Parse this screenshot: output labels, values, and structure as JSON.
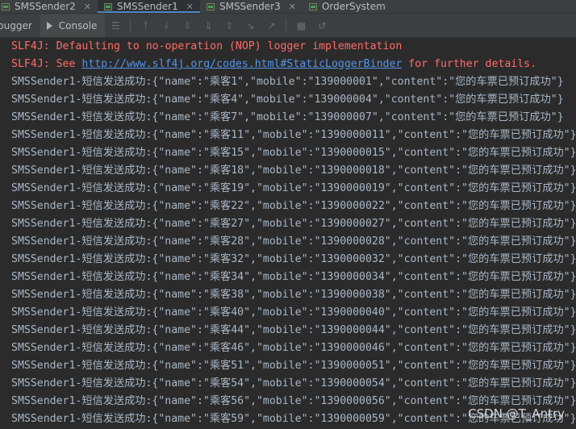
{
  "tabs": [
    {
      "label": "SMSSender2",
      "active": false
    },
    {
      "label": "SMSSender1",
      "active": true
    },
    {
      "label": "SMSSender3",
      "active": false
    },
    {
      "label": "OrderSystem",
      "active": false
    }
  ],
  "toolwindow": {
    "debugger_label": "bugger",
    "console_label": "Console"
  },
  "console": {
    "slf4j_line1": "SLF4J: Defaulting to no-operation (NOP) logger implementation",
    "slf4j_line2_prefix": "SLF4J: See ",
    "slf4j_line2_link": "http://www.slf4j.org/codes.html#StaticLoggerBinder",
    "slf4j_line2_suffix": " for further details.",
    "lines": [
      "SMSSender1-短信发送成功:{\"name\":\"乘客1\",\"mobile\":\"139000001\",\"content\":\"您的车票已预订成功\"}",
      "SMSSender1-短信发送成功:{\"name\":\"乘客4\",\"mobile\":\"139000004\",\"content\":\"您的车票已预订成功\"}",
      "SMSSender1-短信发送成功:{\"name\":\"乘客7\",\"mobile\":\"139000007\",\"content\":\"您的车票已预订成功\"}",
      "SMSSender1-短信发送成功:{\"name\":\"乘客11\",\"mobile\":\"1390000011\",\"content\":\"您的车票已预订成功\"}",
      "SMSSender1-短信发送成功:{\"name\":\"乘客15\",\"mobile\":\"1390000015\",\"content\":\"您的车票已预订成功\"}",
      "SMSSender1-短信发送成功:{\"name\":\"乘客18\",\"mobile\":\"1390000018\",\"content\":\"您的车票已预订成功\"}",
      "SMSSender1-短信发送成功:{\"name\":\"乘客19\",\"mobile\":\"1390000019\",\"content\":\"您的车票已预订成功\"}",
      "SMSSender1-短信发送成功:{\"name\":\"乘客22\",\"mobile\":\"1390000022\",\"content\":\"您的车票已预订成功\"}",
      "SMSSender1-短信发送成功:{\"name\":\"乘客27\",\"mobile\":\"1390000027\",\"content\":\"您的车票已预订成功\"}",
      "SMSSender1-短信发送成功:{\"name\":\"乘客28\",\"mobile\":\"1390000028\",\"content\":\"您的车票已预订成功\"}",
      "SMSSender1-短信发送成功:{\"name\":\"乘客32\",\"mobile\":\"1390000032\",\"content\":\"您的车票已预订成功\"}",
      "SMSSender1-短信发送成功:{\"name\":\"乘客34\",\"mobile\":\"1390000034\",\"content\":\"您的车票已预订成功\"}",
      "SMSSender1-短信发送成功:{\"name\":\"乘客38\",\"mobile\":\"1390000038\",\"content\":\"您的车票已预订成功\"}",
      "SMSSender1-短信发送成功:{\"name\":\"乘客40\",\"mobile\":\"1390000040\",\"content\":\"您的车票已预订成功\"}",
      "SMSSender1-短信发送成功:{\"name\":\"乘客44\",\"mobile\":\"1390000044\",\"content\":\"您的车票已预订成功\"}",
      "SMSSender1-短信发送成功:{\"name\":\"乘客46\",\"mobile\":\"1390000046\",\"content\":\"您的车票已预订成功\"}",
      "SMSSender1-短信发送成功:{\"name\":\"乘客51\",\"mobile\":\"1390000051\",\"content\":\"您的车票已预订成功\"}",
      "SMSSender1-短信发送成功:{\"name\":\"乘客54\",\"mobile\":\"1390000054\",\"content\":\"您的车票已预订成功\"}",
      "SMSSender1-短信发送成功:{\"name\":\"乘客56\",\"mobile\":\"1390000056\",\"content\":\"您的车票已预订成功\"}",
      "SMSSender1-短信发送成功:{\"name\":\"乘客59\",\"mobile\":\"1390000059\",\"content\":\"您的车票已预订成功\"}"
    ]
  },
  "watermark": "CSDN @T_Antry",
  "icons": {
    "tab_icon": "run-config-icon",
    "console_icon": "console-icon",
    "toolbar": [
      "menu-icon",
      "scroll-up-icon",
      "scroll-down-icon",
      "download-icon",
      "download-alt-icon",
      "upload-icon",
      "step-icon",
      "arrow-icon",
      "table-icon",
      "restore-icon"
    ]
  },
  "colors": {
    "error": "#ff6b68",
    "text": "#a9b7c6",
    "link": "#5394ec",
    "background": "#2b2b2b",
    "accent": "#4a88c7"
  }
}
